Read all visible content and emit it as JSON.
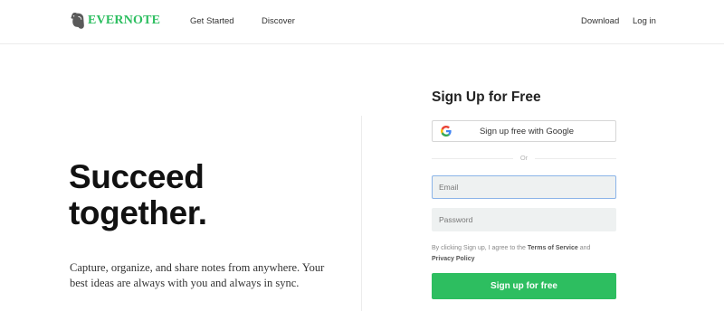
{
  "header": {
    "brand": "EVERNOTE",
    "nav_left": [
      "Get Started",
      "Discover"
    ],
    "nav_right": [
      "Download",
      "Log in"
    ]
  },
  "hero": {
    "headline_lines": [
      "Succeed",
      "together."
    ],
    "tagline_lines": [
      "Capture, organize, and share notes from anywhere. Your",
      "best ideas are always with you and always in sync."
    ]
  },
  "signup": {
    "title": "Sign Up for Free",
    "google_button_label": "Sign up free with Google",
    "divider_text": "Or",
    "email_placeholder": "Email",
    "password_placeholder": "Password",
    "terms_prefix": "By clicking Sign up, I agree to the",
    "terms_of_service": "Terms of Service",
    "terms_and": "and",
    "privacy_policy": "Privacy Policy",
    "submit_label": "Sign up for free"
  },
  "colors": {
    "brand_green": "#2dbe60",
    "input_bg": "#eef1f1",
    "focus_border": "#8bb4e8",
    "google_blue": "#4285F4",
    "google_red": "#EA4335",
    "google_yellow": "#FBBC05",
    "google_green": "#34A853"
  },
  "icons": {
    "logo": "elephant-icon",
    "google": "google-g-icon"
  }
}
